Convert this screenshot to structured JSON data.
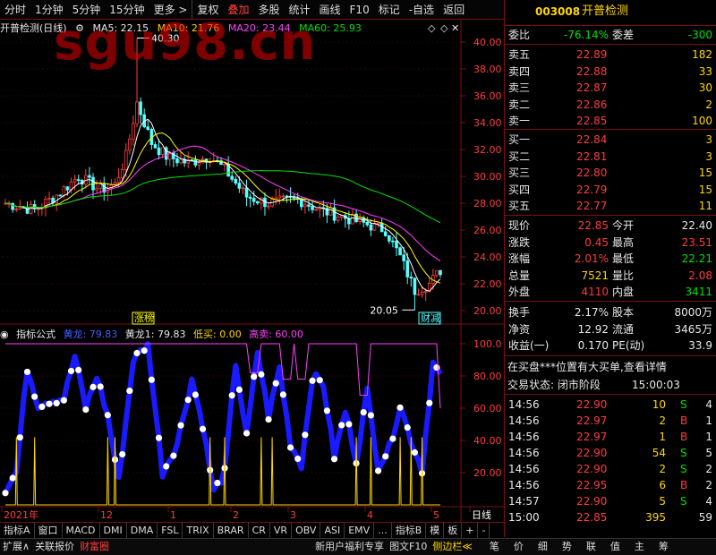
{
  "watermark": "sgu98.cn",
  "toolbar": {
    "items": [
      "分时",
      "1分钟",
      "5分钟",
      "15分钟",
      "更多 >",
      "复权",
      "叠加",
      "多股",
      "统计",
      "画线",
      "F10",
      "标记",
      "-自选",
      "返回"
    ]
  },
  "main_header": {
    "title": "开普检测(日线)",
    "ma5": "MA5: 22.15",
    "ma10": "MA10: 21.76",
    "ma20": "MA20: 23.44",
    "ma60": "MA60: 25.93"
  },
  "main_axis": [
    "40.00",
    "38.00",
    "36.00",
    "34.00",
    "32.00",
    "30.00",
    "28.00",
    "26.00",
    "24.00",
    "22.00",
    "20.00"
  ],
  "annotations": {
    "high": "40.30",
    "low": "20.05",
    "tag1": "涨榜",
    "tag2": "财减"
  },
  "sub_header": {
    "name": "指标公式",
    "huanglong": "黄龙: 79.83",
    "huanglong1": "黄龙1: 79.83",
    "dimai": "低买: 0.00",
    "gaomai": "高卖: 60.00"
  },
  "sub_axis": [
    "100.0",
    "80.00",
    "60.00",
    "40.00",
    "20.00"
  ],
  "time_axis": {
    "year": "2021年",
    "m12": "12",
    "m1": "1",
    "m2": "2",
    "m3": "3",
    "m4": "4",
    "m5": "5",
    "period": "日线"
  },
  "tabs": [
    "指标A",
    "窗口",
    "MACD",
    "DMI",
    "DMA",
    "FSL",
    "TRIX",
    "BRAR",
    "CR",
    "VR",
    "OBV",
    "ASI",
    "EMV",
    "...",
    "指标B",
    "模",
    "板",
    "+",
    "-"
  ],
  "status": {
    "left": [
      "扩展∧",
      "关联报价",
      "财富圈"
    ],
    "mid": [
      "新用户福利专享",
      "图文F10",
      "侧边栏≪"
    ],
    "right": [
      "笔",
      "价",
      "细",
      "势",
      "联",
      "值",
      "主",
      "筹"
    ]
  },
  "stock": {
    "code": "003008",
    "name": "开普检测"
  },
  "weibi": {
    "label1": "委比",
    "value1": "-76.14%",
    "label2": "委差",
    "value2": "-300"
  },
  "asks": [
    {
      "label": "卖五",
      "price": "22.89",
      "vol": "182"
    },
    {
      "label": "卖四",
      "price": "22.88",
      "vol": "33"
    },
    {
      "label": "卖三",
      "price": "22.87",
      "vol": "30"
    },
    {
      "label": "卖二",
      "price": "22.86",
      "vol": "2"
    },
    {
      "label": "卖一",
      "price": "22.85",
      "vol": "100"
    }
  ],
  "bids": [
    {
      "label": "买一",
      "price": "22.84",
      "vol": "3"
    },
    {
      "label": "买二",
      "price": "22.81",
      "vol": "3"
    },
    {
      "label": "买三",
      "price": "22.80",
      "vol": "15"
    },
    {
      "label": "买四",
      "price": "22.79",
      "vol": "15"
    },
    {
      "label": "买五",
      "price": "22.77",
      "vol": "11"
    }
  ],
  "quote": [
    {
      "l1": "现价",
      "v1": "22.85",
      "l2": "今开",
      "v2": "22.40",
      "c1": "red",
      "c2": "white"
    },
    {
      "l1": "涨跌",
      "v1": "0.45",
      "l2": "最高",
      "v2": "23.51",
      "c1": "red",
      "c2": "red"
    },
    {
      "l1": "涨幅",
      "v1": "2.01%",
      "l2": "最低",
      "v2": "22.21",
      "c1": "red",
      "c2": "green"
    },
    {
      "l1": "总量",
      "v1": "7521",
      "l2": "量比",
      "v2": "2.08",
      "c1": "yellow",
      "c2": "red"
    },
    {
      "l1": "外盘",
      "v1": "4110",
      "l2": "内盘",
      "v2": "3411",
      "c1": "red",
      "c2": "green"
    }
  ],
  "fund": [
    {
      "l1": "换手",
      "v1": "2.17%",
      "l2": "股本",
      "v2": "8000万"
    },
    {
      "l1": "净资",
      "v1": "12.92",
      "l2": "流通",
      "v2": "3465万"
    },
    {
      "l1": "收益(一)",
      "v1": "0.170",
      "l2": "PE(动)",
      "v2": "33.9"
    }
  ],
  "notice1": "在买盘***位置有大买单,查看详情",
  "notice2": {
    "label": "交易状态: 闭市阶段",
    "time": "15:00:03"
  },
  "ticks": [
    {
      "t": "14:56",
      "p": "22.90",
      "v": "10",
      "bs": "S",
      "n": "4"
    },
    {
      "t": "14:56",
      "p": "22.97",
      "v": "2",
      "bs": "B",
      "n": "1"
    },
    {
      "t": "14:56",
      "p": "22.97",
      "v": "1",
      "bs": "B",
      "n": "1"
    },
    {
      "t": "14:56",
      "p": "22.90",
      "v": "54",
      "bs": "S",
      "n": "5"
    },
    {
      "t": "14:56",
      "p": "22.90",
      "v": "2",
      "bs": "S",
      "n": "2"
    },
    {
      "t": "14:56",
      "p": "22.95",
      "v": "6",
      "bs": "B",
      "n": "2"
    },
    {
      "t": "14:57",
      "p": "22.90",
      "v": "5",
      "bs": "S",
      "n": "4"
    },
    {
      "t": "15:00",
      "p": "22.85",
      "v": "395",
      "bs": "",
      "n": "59"
    }
  ]
}
